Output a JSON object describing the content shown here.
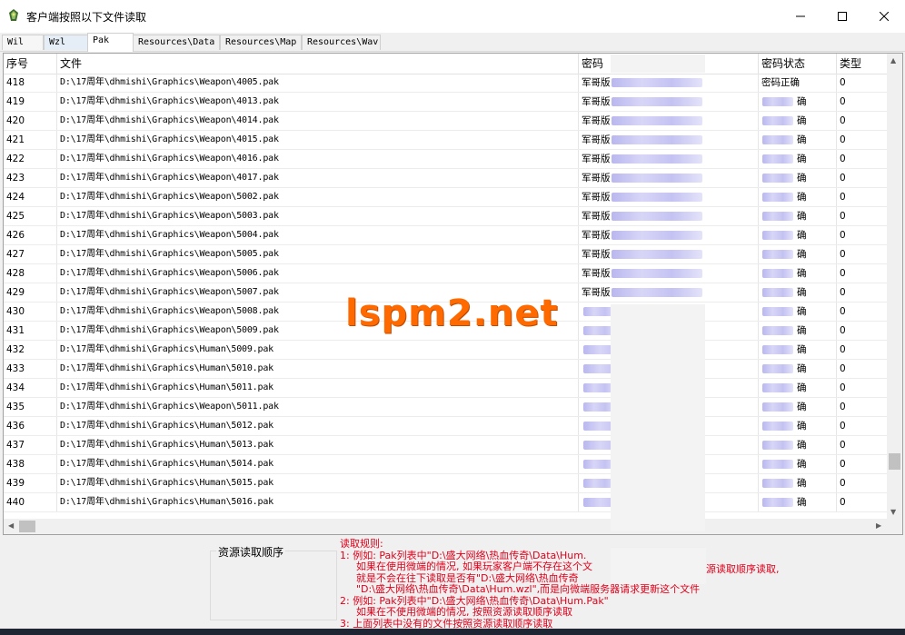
{
  "window": {
    "title": "客户端按照以下文件读取"
  },
  "tabs": [
    "Wil",
    "Wzl",
    "Pak",
    "Resources\\Data",
    "Resources\\Map",
    "Resources\\Wav"
  ],
  "columns": {
    "no": "序号",
    "file": "文件",
    "password": "密码",
    "status": "密码状态",
    "type": "类型"
  },
  "rows": [
    {
      "no": "418",
      "file": "D:\\17周年\\dhmishi\\Graphics\\Weapon\\4005.pak",
      "pw": "军哥版",
      "status": "密码正确",
      "type": "0"
    },
    {
      "no": "419",
      "file": "D:\\17周年\\dhmishi\\Graphics\\Weapon\\4013.pak",
      "pw": "军哥版",
      "status": "确",
      "type": "0"
    },
    {
      "no": "420",
      "file": "D:\\17周年\\dhmishi\\Graphics\\Weapon\\4014.pak",
      "pw": "军哥版",
      "status": "确",
      "type": "0"
    },
    {
      "no": "421",
      "file": "D:\\17周年\\dhmishi\\Graphics\\Weapon\\4015.pak",
      "pw": "军哥版",
      "status": "确",
      "type": "0"
    },
    {
      "no": "422",
      "file": "D:\\17周年\\dhmishi\\Graphics\\Weapon\\4016.pak",
      "pw": "军哥版",
      "status": "确",
      "type": "0"
    },
    {
      "no": "423",
      "file": "D:\\17周年\\dhmishi\\Graphics\\Weapon\\4017.pak",
      "pw": "军哥版",
      "status": "确",
      "type": "0"
    },
    {
      "no": "424",
      "file": "D:\\17周年\\dhmishi\\Graphics\\Weapon\\5002.pak",
      "pw": "军哥版",
      "status": "确",
      "type": "0"
    },
    {
      "no": "425",
      "file": "D:\\17周年\\dhmishi\\Graphics\\Weapon\\5003.pak",
      "pw": "军哥版",
      "status": "确",
      "type": "0"
    },
    {
      "no": "426",
      "file": "D:\\17周年\\dhmishi\\Graphics\\Weapon\\5004.pak",
      "pw": "军哥版",
      "status": "确",
      "type": "0"
    },
    {
      "no": "427",
      "file": "D:\\17周年\\dhmishi\\Graphics\\Weapon\\5005.pak",
      "pw": "军哥版",
      "status": "确",
      "type": "0"
    },
    {
      "no": "428",
      "file": "D:\\17周年\\dhmishi\\Graphics\\Weapon\\5006.pak",
      "pw": "军哥版",
      "status": "确",
      "type": "0"
    },
    {
      "no": "429",
      "file": "D:\\17周年\\dhmishi\\Graphics\\Weapon\\5007.pak",
      "pw": "军哥版",
      "status": "确",
      "type": "0"
    },
    {
      "no": "430",
      "file": "D:\\17周年\\dhmishi\\Graphics\\Weapon\\5008.pak",
      "pw": "",
      "status": "确",
      "type": "0"
    },
    {
      "no": "431",
      "file": "D:\\17周年\\dhmishi\\Graphics\\Weapon\\5009.pak",
      "pw": "",
      "status": "确",
      "type": "0"
    },
    {
      "no": "432",
      "file": "D:\\17周年\\dhmishi\\Graphics\\Human\\5009.pak",
      "pw": "",
      "status": "确",
      "type": "0"
    },
    {
      "no": "433",
      "file": "D:\\17周年\\dhmishi\\Graphics\\Human\\5010.pak",
      "pw": "",
      "status": "确",
      "type": "0"
    },
    {
      "no": "434",
      "file": "D:\\17周年\\dhmishi\\Graphics\\Human\\5011.pak",
      "pw": "",
      "status": "确",
      "type": "0"
    },
    {
      "no": "435",
      "file": "D:\\17周年\\dhmishi\\Graphics\\Weapon\\5011.pak",
      "pw": "",
      "status": "确",
      "type": "0"
    },
    {
      "no": "436",
      "file": "D:\\17周年\\dhmishi\\Graphics\\Human\\5012.pak",
      "pw": "",
      "status": "确",
      "type": "0"
    },
    {
      "no": "437",
      "file": "D:\\17周年\\dhmishi\\Graphics\\Human\\5013.pak",
      "pw": "",
      "status": "确",
      "type": "0"
    },
    {
      "no": "438",
      "file": "D:\\17周年\\dhmishi\\Graphics\\Human\\5014.pak",
      "pw": "",
      "status": "确",
      "type": "0"
    },
    {
      "no": "439",
      "file": "D:\\17周年\\dhmishi\\Graphics\\Human\\5015.pak",
      "pw": "",
      "status": "确",
      "type": "0"
    },
    {
      "no": "440",
      "file": "D:\\17周年\\dhmishi\\Graphics\\Human\\5016.pak",
      "pw": "",
      "status": "确",
      "type": "0"
    }
  ],
  "groupbox": {
    "label": "资源读取顺序"
  },
  "rules": [
    {
      "text": "读取规则:",
      "indent": false
    },
    {
      "text": "1: 例如: Pak列表中\"D:\\盛大网络\\热血传奇\\Data\\Hum.",
      "indent": false
    },
    {
      "text": "如果在使用微端的情况, 如果玩家客户端不存在这个文",
      "indent": true
    },
    {
      "text": "就是不会在往下读取是否有\"D:\\盛大网络\\热血传奇",
      "indent": true
    },
    {
      "text": "\"D:\\盛大网络\\热血传奇\\Data\\Hum.wzl\",而是向微端服务器请求更新这个文件",
      "indent": true
    },
    {
      "text": "2: 例如: Pak列表中\"D:\\盛大网络\\热血传奇\\Data\\Hum.Pak\"",
      "indent": false
    },
    {
      "text": "如果在不使用微端的情况, 按照资源读取顺序读取",
      "indent": true
    },
    {
      "text": "3: 上面列表中没有的文件按照资源读取顺序读取",
      "indent": false
    }
  ],
  "rules_tail": "源读取顺序读取,",
  "watermark": "lspm2.net"
}
